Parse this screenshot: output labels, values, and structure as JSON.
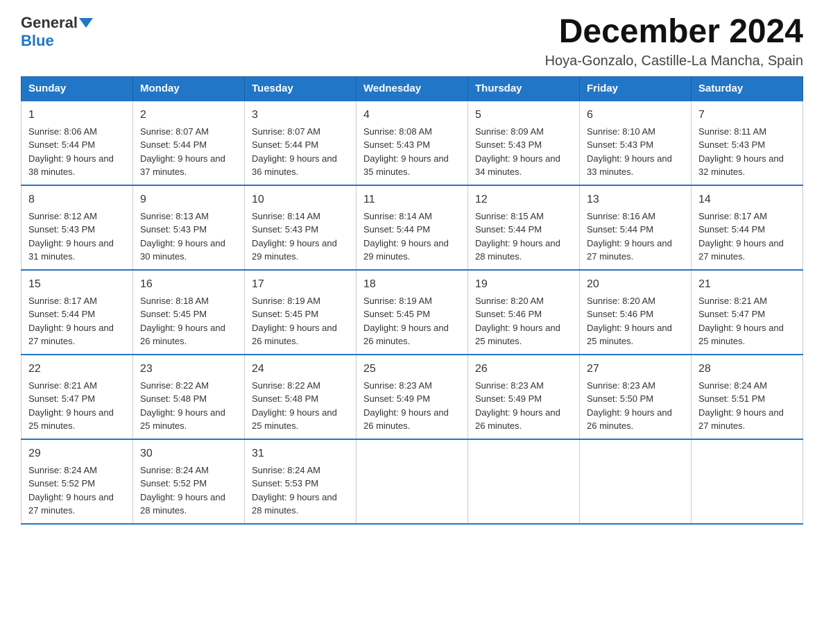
{
  "logo": {
    "text_general": "General",
    "text_blue": "Blue"
  },
  "header": {
    "month_title": "December 2024",
    "location": "Hoya-Gonzalo, Castille-La Mancha, Spain"
  },
  "weekdays": [
    "Sunday",
    "Monday",
    "Tuesday",
    "Wednesday",
    "Thursday",
    "Friday",
    "Saturday"
  ],
  "weeks": [
    [
      {
        "day": "1",
        "sunrise": "8:06 AM",
        "sunset": "5:44 PM",
        "daylight": "9 hours and 38 minutes."
      },
      {
        "day": "2",
        "sunrise": "8:07 AM",
        "sunset": "5:44 PM",
        "daylight": "9 hours and 37 minutes."
      },
      {
        "day": "3",
        "sunrise": "8:07 AM",
        "sunset": "5:44 PM",
        "daylight": "9 hours and 36 minutes."
      },
      {
        "day": "4",
        "sunrise": "8:08 AM",
        "sunset": "5:43 PM",
        "daylight": "9 hours and 35 minutes."
      },
      {
        "day": "5",
        "sunrise": "8:09 AM",
        "sunset": "5:43 PM",
        "daylight": "9 hours and 34 minutes."
      },
      {
        "day": "6",
        "sunrise": "8:10 AM",
        "sunset": "5:43 PM",
        "daylight": "9 hours and 33 minutes."
      },
      {
        "day": "7",
        "sunrise": "8:11 AM",
        "sunset": "5:43 PM",
        "daylight": "9 hours and 32 minutes."
      }
    ],
    [
      {
        "day": "8",
        "sunrise": "8:12 AM",
        "sunset": "5:43 PM",
        "daylight": "9 hours and 31 minutes."
      },
      {
        "day": "9",
        "sunrise": "8:13 AM",
        "sunset": "5:43 PM",
        "daylight": "9 hours and 30 minutes."
      },
      {
        "day": "10",
        "sunrise": "8:14 AM",
        "sunset": "5:43 PM",
        "daylight": "9 hours and 29 minutes."
      },
      {
        "day": "11",
        "sunrise": "8:14 AM",
        "sunset": "5:44 PM",
        "daylight": "9 hours and 29 minutes."
      },
      {
        "day": "12",
        "sunrise": "8:15 AM",
        "sunset": "5:44 PM",
        "daylight": "9 hours and 28 minutes."
      },
      {
        "day": "13",
        "sunrise": "8:16 AM",
        "sunset": "5:44 PM",
        "daylight": "9 hours and 27 minutes."
      },
      {
        "day": "14",
        "sunrise": "8:17 AM",
        "sunset": "5:44 PM",
        "daylight": "9 hours and 27 minutes."
      }
    ],
    [
      {
        "day": "15",
        "sunrise": "8:17 AM",
        "sunset": "5:44 PM",
        "daylight": "9 hours and 27 minutes."
      },
      {
        "day": "16",
        "sunrise": "8:18 AM",
        "sunset": "5:45 PM",
        "daylight": "9 hours and 26 minutes."
      },
      {
        "day": "17",
        "sunrise": "8:19 AM",
        "sunset": "5:45 PM",
        "daylight": "9 hours and 26 minutes."
      },
      {
        "day": "18",
        "sunrise": "8:19 AM",
        "sunset": "5:45 PM",
        "daylight": "9 hours and 26 minutes."
      },
      {
        "day": "19",
        "sunrise": "8:20 AM",
        "sunset": "5:46 PM",
        "daylight": "9 hours and 25 minutes."
      },
      {
        "day": "20",
        "sunrise": "8:20 AM",
        "sunset": "5:46 PM",
        "daylight": "9 hours and 25 minutes."
      },
      {
        "day": "21",
        "sunrise": "8:21 AM",
        "sunset": "5:47 PM",
        "daylight": "9 hours and 25 minutes."
      }
    ],
    [
      {
        "day": "22",
        "sunrise": "8:21 AM",
        "sunset": "5:47 PM",
        "daylight": "9 hours and 25 minutes."
      },
      {
        "day": "23",
        "sunrise": "8:22 AM",
        "sunset": "5:48 PM",
        "daylight": "9 hours and 25 minutes."
      },
      {
        "day": "24",
        "sunrise": "8:22 AM",
        "sunset": "5:48 PM",
        "daylight": "9 hours and 25 minutes."
      },
      {
        "day": "25",
        "sunrise": "8:23 AM",
        "sunset": "5:49 PM",
        "daylight": "9 hours and 26 minutes."
      },
      {
        "day": "26",
        "sunrise": "8:23 AM",
        "sunset": "5:49 PM",
        "daylight": "9 hours and 26 minutes."
      },
      {
        "day": "27",
        "sunrise": "8:23 AM",
        "sunset": "5:50 PM",
        "daylight": "9 hours and 26 minutes."
      },
      {
        "day": "28",
        "sunrise": "8:24 AM",
        "sunset": "5:51 PM",
        "daylight": "9 hours and 27 minutes."
      }
    ],
    [
      {
        "day": "29",
        "sunrise": "8:24 AM",
        "sunset": "5:52 PM",
        "daylight": "9 hours and 27 minutes."
      },
      {
        "day": "30",
        "sunrise": "8:24 AM",
        "sunset": "5:52 PM",
        "daylight": "9 hours and 28 minutes."
      },
      {
        "day": "31",
        "sunrise": "8:24 AM",
        "sunset": "5:53 PM",
        "daylight": "9 hours and 28 minutes."
      },
      null,
      null,
      null,
      null
    ]
  ]
}
